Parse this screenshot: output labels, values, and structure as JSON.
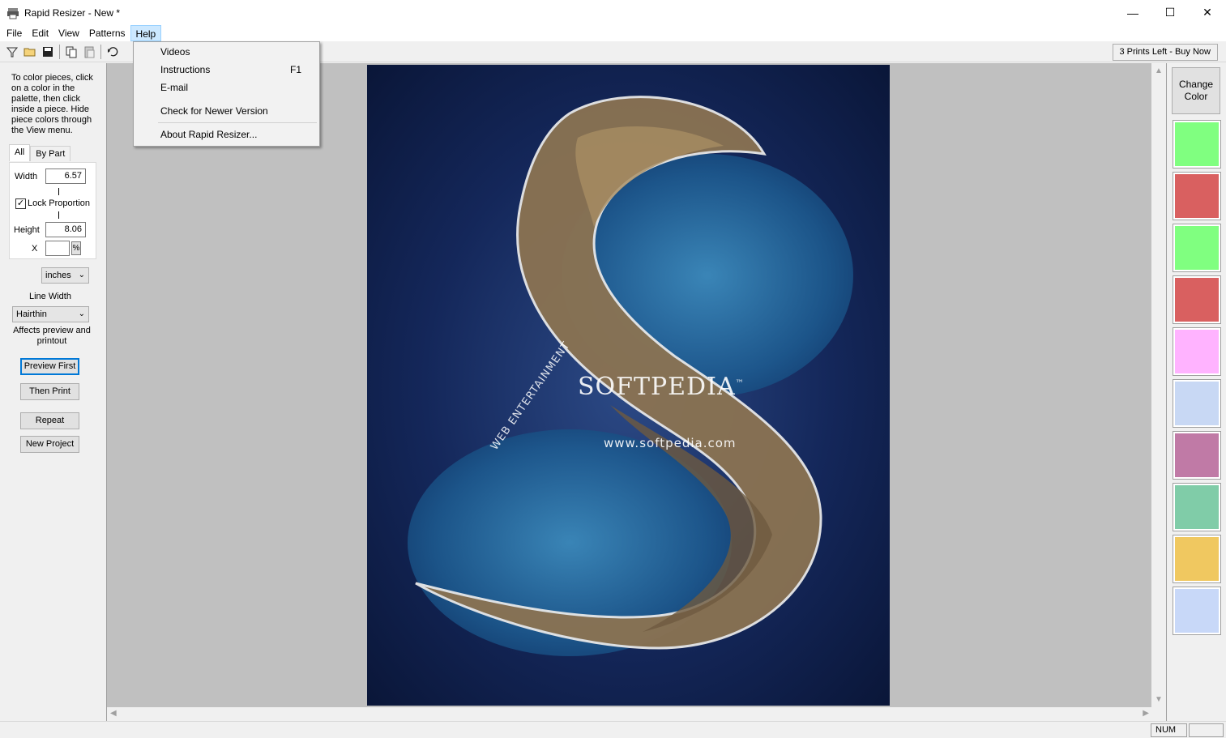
{
  "window": {
    "title": "Rapid Resizer - New *",
    "controls": {
      "minimize": "—",
      "maximize": "☐",
      "close": "✕"
    }
  },
  "menubar": {
    "file": "File",
    "edit": "Edit",
    "view": "View",
    "patterns": "Patterns",
    "help": "Help"
  },
  "toolbar": {
    "buy_now": "3 Prints Left - Buy Now"
  },
  "help_menu": {
    "videos": "Videos",
    "instructions": "Instructions",
    "instructions_shortcut": "F1",
    "email": "E-mail",
    "check_newer": "Check for Newer Version",
    "about": "About Rapid Resizer..."
  },
  "left_panel": {
    "help_text": "To color pieces, click on a color in the palette, then click inside a piece. Hide piece colors through the View menu.",
    "tab_all": "All",
    "tab_by_part": "By Part",
    "width_label": "Width",
    "width_value": "6.57",
    "lock_label": "Lock Proportion",
    "lock_checked": true,
    "height_label": "Height",
    "height_value": "8.06",
    "x_label": "X",
    "x_value": "",
    "pct_label": "%",
    "units": "inches",
    "line_width_label": "Line Width",
    "line_width_value": "Hairthin",
    "affects_text": "Affects preview and printout",
    "preview_first": "Preview First",
    "then_print": "Then Print",
    "repeat": "Repeat",
    "new_project": "New Project"
  },
  "canvas": {
    "brand_text": "SOFTPEDIA",
    "brand_tm": "™",
    "url_text": "www.softpedia.com",
    "tagline": "WEB ENTERTAINMENT"
  },
  "right_panel": {
    "change_color": "Change Color",
    "swatches": [
      "#80ff80",
      "#d96060",
      "#80ff80",
      "#d96060",
      "#ffb3ff",
      "#c8d8f4",
      "#c07aa6",
      "#80cca8",
      "#f0c860",
      "#c8d8f8"
    ]
  },
  "statusbar": {
    "num": "NUM"
  }
}
